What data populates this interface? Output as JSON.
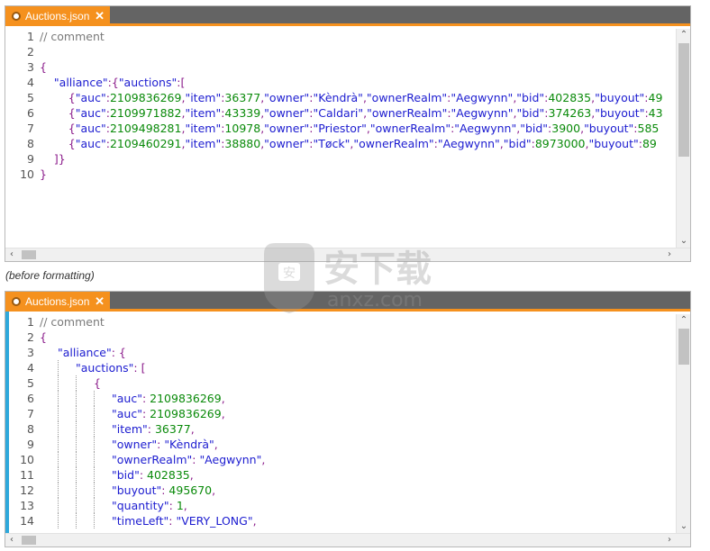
{
  "before_editor": {
    "tab": {
      "title": "Auctions.json",
      "close_glyph": "✕"
    },
    "lines": [
      {
        "n": "1",
        "tokens": [
          {
            "t": "// comment",
            "c": "comment"
          }
        ]
      },
      {
        "n": "2",
        "tokens": []
      },
      {
        "n": "3",
        "tokens": [
          {
            "t": "{",
            "c": "punc"
          }
        ]
      },
      {
        "n": "4",
        "tokens": [
          {
            "t": "    "
          },
          {
            "t": "\"alliance\"",
            "c": "key"
          },
          {
            "t": ":{",
            "c": "punc"
          },
          {
            "t": "\"auctions\"",
            "c": "key"
          },
          {
            "t": ":[",
            "c": "punc"
          }
        ]
      },
      {
        "n": "5",
        "tokens": [
          {
            "t": "        "
          },
          {
            "t": "{",
            "c": "punc"
          },
          {
            "t": "\"auc\"",
            "c": "key"
          },
          {
            "t": ":",
            "c": "punc"
          },
          {
            "t": "2109836269",
            "c": "num"
          },
          {
            "t": ",",
            "c": "punc"
          },
          {
            "t": "\"item\"",
            "c": "key"
          },
          {
            "t": ":",
            "c": "punc"
          },
          {
            "t": "36377",
            "c": "num"
          },
          {
            "t": ",",
            "c": "punc"
          },
          {
            "t": "\"owner\"",
            "c": "key"
          },
          {
            "t": ":",
            "c": "punc"
          },
          {
            "t": "\"Kèndrà\"",
            "c": "str"
          },
          {
            "t": ",",
            "c": "punc"
          },
          {
            "t": "\"ownerRealm\"",
            "c": "key"
          },
          {
            "t": ":",
            "c": "punc"
          },
          {
            "t": "\"Aegwynn\"",
            "c": "str"
          },
          {
            "t": ",",
            "c": "punc"
          },
          {
            "t": "\"bid\"",
            "c": "key"
          },
          {
            "t": ":",
            "c": "punc"
          },
          {
            "t": "402835",
            "c": "num"
          },
          {
            "t": ",",
            "c": "punc"
          },
          {
            "t": "\"buyout\"",
            "c": "key"
          },
          {
            "t": ":",
            "c": "punc"
          },
          {
            "t": "49",
            "c": "num"
          }
        ]
      },
      {
        "n": "6",
        "tokens": [
          {
            "t": "        "
          },
          {
            "t": "{",
            "c": "punc"
          },
          {
            "t": "\"auc\"",
            "c": "key"
          },
          {
            "t": ":",
            "c": "punc"
          },
          {
            "t": "2109971882",
            "c": "num"
          },
          {
            "t": ",",
            "c": "punc"
          },
          {
            "t": "\"item\"",
            "c": "key"
          },
          {
            "t": ":",
            "c": "punc"
          },
          {
            "t": "43339",
            "c": "num"
          },
          {
            "t": ",",
            "c": "punc"
          },
          {
            "t": "\"owner\"",
            "c": "key"
          },
          {
            "t": ":",
            "c": "punc"
          },
          {
            "t": "\"Caldari\"",
            "c": "str"
          },
          {
            "t": ",",
            "c": "punc"
          },
          {
            "t": "\"ownerRealm\"",
            "c": "key"
          },
          {
            "t": ":",
            "c": "punc"
          },
          {
            "t": "\"Aegwynn\"",
            "c": "str"
          },
          {
            "t": ",",
            "c": "punc"
          },
          {
            "t": "\"bid\"",
            "c": "key"
          },
          {
            "t": ":",
            "c": "punc"
          },
          {
            "t": "374263",
            "c": "num"
          },
          {
            "t": ",",
            "c": "punc"
          },
          {
            "t": "\"buyout\"",
            "c": "key"
          },
          {
            "t": ":",
            "c": "punc"
          },
          {
            "t": "43",
            "c": "num"
          }
        ]
      },
      {
        "n": "7",
        "tokens": [
          {
            "t": "        "
          },
          {
            "t": "{",
            "c": "punc"
          },
          {
            "t": "\"auc\"",
            "c": "key"
          },
          {
            "t": ":",
            "c": "punc"
          },
          {
            "t": "2109498281",
            "c": "num"
          },
          {
            "t": ",",
            "c": "punc"
          },
          {
            "t": "\"item\"",
            "c": "key"
          },
          {
            "t": ":",
            "c": "punc"
          },
          {
            "t": "10978",
            "c": "num"
          },
          {
            "t": ",",
            "c": "punc"
          },
          {
            "t": "\"owner\"",
            "c": "key"
          },
          {
            "t": ":",
            "c": "punc"
          },
          {
            "t": "\"Priestor\"",
            "c": "str"
          },
          {
            "t": ",",
            "c": "punc"
          },
          {
            "t": "\"ownerRealm\"",
            "c": "key"
          },
          {
            "t": ":",
            "c": "punc"
          },
          {
            "t": "\"Aegwynn\"",
            "c": "str"
          },
          {
            "t": ",",
            "c": "punc"
          },
          {
            "t": "\"bid\"",
            "c": "key"
          },
          {
            "t": ":",
            "c": "punc"
          },
          {
            "t": "3900",
            "c": "num"
          },
          {
            "t": ",",
            "c": "punc"
          },
          {
            "t": "\"buyout\"",
            "c": "key"
          },
          {
            "t": ":",
            "c": "punc"
          },
          {
            "t": "585",
            "c": "num"
          }
        ]
      },
      {
        "n": "8",
        "tokens": [
          {
            "t": "        "
          },
          {
            "t": "{",
            "c": "punc"
          },
          {
            "t": "\"auc\"",
            "c": "key"
          },
          {
            "t": ":",
            "c": "punc"
          },
          {
            "t": "2109460291",
            "c": "num"
          },
          {
            "t": ",",
            "c": "punc"
          },
          {
            "t": "\"item\"",
            "c": "key"
          },
          {
            "t": ":",
            "c": "punc"
          },
          {
            "t": "38880",
            "c": "num"
          },
          {
            "t": ",",
            "c": "punc"
          },
          {
            "t": "\"owner\"",
            "c": "key"
          },
          {
            "t": ":",
            "c": "punc"
          },
          {
            "t": "\"Tøck\"",
            "c": "str"
          },
          {
            "t": ",",
            "c": "punc"
          },
          {
            "t": "\"ownerRealm\"",
            "c": "key"
          },
          {
            "t": ":",
            "c": "punc"
          },
          {
            "t": "\"Aegwynn\"",
            "c": "str"
          },
          {
            "t": ",",
            "c": "punc"
          },
          {
            "t": "\"bid\"",
            "c": "key"
          },
          {
            "t": ":",
            "c": "punc"
          },
          {
            "t": "8973000",
            "c": "num"
          },
          {
            "t": ",",
            "c": "punc"
          },
          {
            "t": "\"buyout\"",
            "c": "key"
          },
          {
            "t": ":",
            "c": "punc"
          },
          {
            "t": "89",
            "c": "num"
          }
        ]
      },
      {
        "n": "9",
        "tokens": [
          {
            "t": "    "
          },
          {
            "t": "]}",
            "c": "punc"
          }
        ]
      },
      {
        "n": "10",
        "tokens": [
          {
            "t": "}",
            "c": "punc"
          }
        ]
      }
    ]
  },
  "caption": "(before formatting)",
  "after_editor": {
    "tab": {
      "title": "Auctions.json",
      "close_glyph": "✕"
    },
    "lines": [
      {
        "n": "1",
        "guides": 0,
        "tokens": [
          {
            "t": "// comment",
            "c": "comment"
          }
        ]
      },
      {
        "n": "2",
        "guides": 0,
        "tokens": [
          {
            "t": "{",
            "c": "punc"
          }
        ]
      },
      {
        "n": "3",
        "guides": 1,
        "tokens": [
          {
            "t": "\"alliance\"",
            "c": "key"
          },
          {
            "t": ": {",
            "c": "punc"
          }
        ]
      },
      {
        "n": "4",
        "guides": 2,
        "tokens": [
          {
            "t": "\"auctions\"",
            "c": "key"
          },
          {
            "t": ": [",
            "c": "punc"
          }
        ]
      },
      {
        "n": "5",
        "guides": 3,
        "tokens": [
          {
            "t": "{",
            "c": "punc"
          }
        ]
      },
      {
        "n": "6",
        "guides": 4,
        "tokens": [
          {
            "t": "\"auc\"",
            "c": "key"
          },
          {
            "t": ": ",
            "c": "punc"
          },
          {
            "t": "2109836269",
            "c": "num"
          },
          {
            "t": ",",
            "c": "punc"
          }
        ]
      },
      {
        "n": "7",
        "guides": 4,
        "tokens": [
          {
            "t": "\"auc\"",
            "c": "key"
          },
          {
            "t": ": ",
            "c": "punc"
          },
          {
            "t": "2109836269",
            "c": "num"
          },
          {
            "t": ",",
            "c": "punc"
          }
        ]
      },
      {
        "n": "8",
        "guides": 4,
        "tokens": [
          {
            "t": "\"item\"",
            "c": "key"
          },
          {
            "t": ": ",
            "c": "punc"
          },
          {
            "t": "36377",
            "c": "num"
          },
          {
            "t": ",",
            "c": "punc"
          }
        ]
      },
      {
        "n": "9",
        "guides": 4,
        "tokens": [
          {
            "t": "\"owner\"",
            "c": "key"
          },
          {
            "t": ": ",
            "c": "punc"
          },
          {
            "t": "\"Kèndrà\"",
            "c": "str"
          },
          {
            "t": ",",
            "c": "punc"
          }
        ]
      },
      {
        "n": "10",
        "guides": 4,
        "tokens": [
          {
            "t": "\"ownerRealm\"",
            "c": "key"
          },
          {
            "t": ": ",
            "c": "punc"
          },
          {
            "t": "\"Aegwynn\"",
            "c": "str"
          },
          {
            "t": ",",
            "c": "punc"
          }
        ]
      },
      {
        "n": "11",
        "guides": 4,
        "tokens": [
          {
            "t": "\"bid\"",
            "c": "key"
          },
          {
            "t": ": ",
            "c": "punc"
          },
          {
            "t": "402835",
            "c": "num"
          },
          {
            "t": ",",
            "c": "punc"
          }
        ]
      },
      {
        "n": "12",
        "guides": 4,
        "tokens": [
          {
            "t": "\"buyout\"",
            "c": "key"
          },
          {
            "t": ": ",
            "c": "punc"
          },
          {
            "t": "495670",
            "c": "num"
          },
          {
            "t": ",",
            "c": "punc"
          }
        ]
      },
      {
        "n": "13",
        "guides": 4,
        "tokens": [
          {
            "t": "\"quantity\"",
            "c": "key"
          },
          {
            "t": ": ",
            "c": "punc"
          },
          {
            "t": "1",
            "c": "num"
          },
          {
            "t": ",",
            "c": "punc"
          }
        ]
      },
      {
        "n": "14",
        "guides": 4,
        "tokens": [
          {
            "t": "\"timeLeft\"",
            "c": "key"
          },
          {
            "t": ": ",
            "c": "punc"
          },
          {
            "t": "\"VERY_LONG\"",
            "c": "str"
          },
          {
            "t": ",",
            "c": "punc"
          }
        ]
      }
    ]
  },
  "watermark": {
    "text": "安下载",
    "subtext": "anxz.com"
  },
  "colors": {
    "accent": "#f5911e",
    "tabbar": "#646464",
    "key": "#1c1cd0",
    "number": "#0a8a0a",
    "punctuation": "#8a1a8a",
    "comment": "#7a7a7a",
    "gutter_strip": "#2ea8db"
  }
}
